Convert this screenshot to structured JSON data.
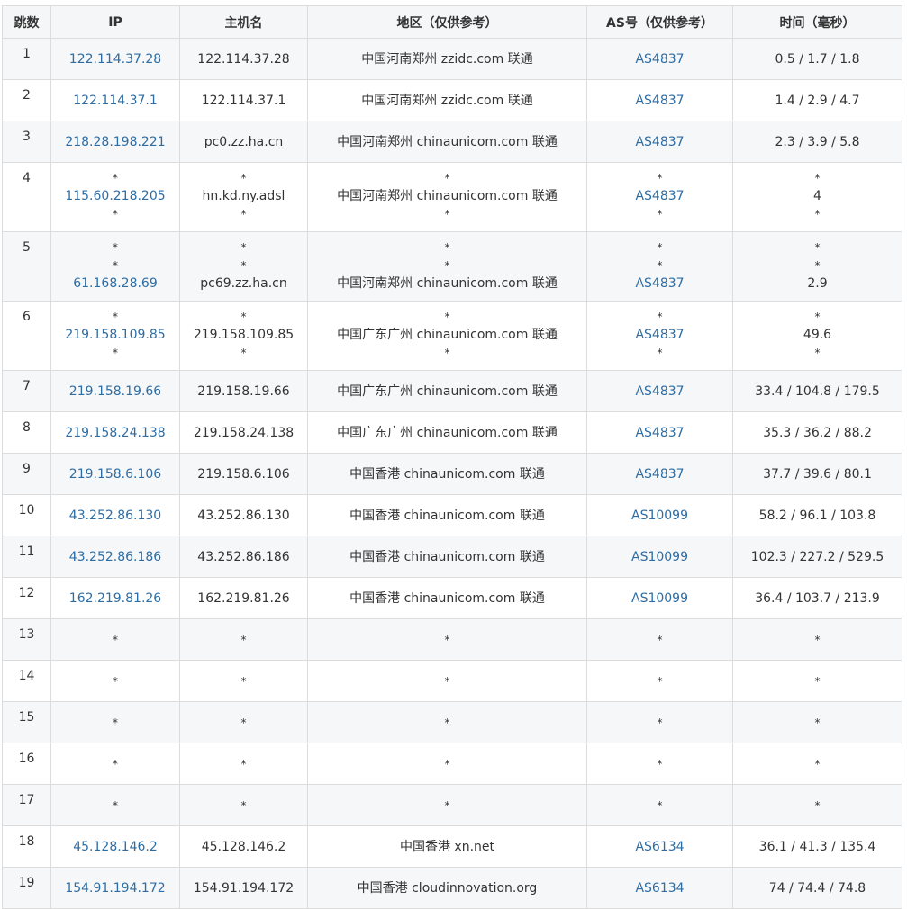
{
  "headers": {
    "hop": "跳数",
    "ip": "IP",
    "host": "主机名",
    "region": "地区（仅供参考）",
    "as": "AS号（仅供参考）",
    "time": "时间（毫秒）"
  },
  "rows": [
    {
      "hop": "1",
      "ip": [
        "122.114.37.28"
      ],
      "host": [
        "122.114.37.28"
      ],
      "region": [
        "中国河南郑州 zzidc.com 联通"
      ],
      "as": [
        "AS4837"
      ],
      "time": [
        "0.5 / 1.7 / 1.8"
      ]
    },
    {
      "hop": "2",
      "ip": [
        "122.114.37.1"
      ],
      "host": [
        "122.114.37.1"
      ],
      "region": [
        "中国河南郑州 zzidc.com 联通"
      ],
      "as": [
        "AS4837"
      ],
      "time": [
        "1.4 / 2.9 / 4.7"
      ]
    },
    {
      "hop": "3",
      "ip": [
        "218.28.198.221"
      ],
      "host": [
        "pc0.zz.ha.cn"
      ],
      "region": [
        "中国河南郑州 chinaunicom.com 联通"
      ],
      "as": [
        "AS4837"
      ],
      "time": [
        "2.3 / 3.9 / 5.8"
      ]
    },
    {
      "hop": "4",
      "ip": [
        "*",
        "115.60.218.205",
        "*"
      ],
      "host": [
        "*",
        "hn.kd.ny.adsl",
        "*"
      ],
      "region": [
        "*",
        "中国河南郑州 chinaunicom.com 联通",
        "*"
      ],
      "as": [
        "*",
        "AS4837",
        "*"
      ],
      "time": [
        "*",
        "4",
        "*"
      ]
    },
    {
      "hop": "5",
      "ip": [
        "*",
        "*",
        "61.168.28.69"
      ],
      "host": [
        "*",
        "*",
        "pc69.zz.ha.cn"
      ],
      "region": [
        "*",
        "*",
        "中国河南郑州 chinaunicom.com 联通"
      ],
      "as": [
        "*",
        "*",
        "AS4837"
      ],
      "time": [
        "*",
        "*",
        "2.9"
      ]
    },
    {
      "hop": "6",
      "ip": [
        "*",
        "219.158.109.85",
        "*"
      ],
      "host": [
        "*",
        "219.158.109.85",
        "*"
      ],
      "region": [
        "*",
        "中国广东广州 chinaunicom.com 联通",
        "*"
      ],
      "as": [
        "*",
        "AS4837",
        "*"
      ],
      "time": [
        "*",
        "49.6",
        "*"
      ]
    },
    {
      "hop": "7",
      "ip": [
        "219.158.19.66"
      ],
      "host": [
        "219.158.19.66"
      ],
      "region": [
        "中国广东广州 chinaunicom.com 联通"
      ],
      "as": [
        "AS4837"
      ],
      "time": [
        "33.4 / 104.8 / 179.5"
      ]
    },
    {
      "hop": "8",
      "ip": [
        "219.158.24.138"
      ],
      "host": [
        "219.158.24.138"
      ],
      "region": [
        "中国广东广州 chinaunicom.com 联通"
      ],
      "as": [
        "AS4837"
      ],
      "time": [
        "35.3 / 36.2 / 88.2"
      ]
    },
    {
      "hop": "9",
      "ip": [
        "219.158.6.106"
      ],
      "host": [
        "219.158.6.106"
      ],
      "region": [
        "中国香港 chinaunicom.com 联通"
      ],
      "as": [
        "AS4837"
      ],
      "time": [
        "37.7 / 39.6 / 80.1"
      ]
    },
    {
      "hop": "10",
      "ip": [
        "43.252.86.130"
      ],
      "host": [
        "43.252.86.130"
      ],
      "region": [
        "中国香港 chinaunicom.com 联通"
      ],
      "as": [
        "AS10099"
      ],
      "time": [
        "58.2 / 96.1 / 103.8"
      ]
    },
    {
      "hop": "11",
      "ip": [
        "43.252.86.186"
      ],
      "host": [
        "43.252.86.186"
      ],
      "region": [
        "中国香港 chinaunicom.com 联通"
      ],
      "as": [
        "AS10099"
      ],
      "time": [
        "102.3 / 227.2 / 529.5"
      ]
    },
    {
      "hop": "12",
      "ip": [
        "162.219.81.26"
      ],
      "host": [
        "162.219.81.26"
      ],
      "region": [
        "中国香港 chinaunicom.com 联通"
      ],
      "as": [
        "AS10099"
      ],
      "time": [
        "36.4 / 103.7 / 213.9"
      ]
    },
    {
      "hop": "13",
      "ip": [
        "*"
      ],
      "host": [
        "*"
      ],
      "region": [
        "*"
      ],
      "as": [
        "*"
      ],
      "time": [
        "*"
      ]
    },
    {
      "hop": "14",
      "ip": [
        "*"
      ],
      "host": [
        "*"
      ],
      "region": [
        "*"
      ],
      "as": [
        "*"
      ],
      "time": [
        "*"
      ]
    },
    {
      "hop": "15",
      "ip": [
        "*"
      ],
      "host": [
        "*"
      ],
      "region": [
        "*"
      ],
      "as": [
        "*"
      ],
      "time": [
        "*"
      ]
    },
    {
      "hop": "16",
      "ip": [
        "*"
      ],
      "host": [
        "*"
      ],
      "region": [
        "*"
      ],
      "as": [
        "*"
      ],
      "time": [
        "*"
      ]
    },
    {
      "hop": "17",
      "ip": [
        "*"
      ],
      "host": [
        "*"
      ],
      "region": [
        "*"
      ],
      "as": [
        "*"
      ],
      "time": [
        "*"
      ]
    },
    {
      "hop": "18",
      "ip": [
        "45.128.146.2"
      ],
      "host": [
        "45.128.146.2"
      ],
      "region": [
        "中国香港 xn.net"
      ],
      "as": [
        "AS6134"
      ],
      "time": [
        "36.1 / 41.3 / 135.4"
      ]
    },
    {
      "hop": "19",
      "ip": [
        "154.91.194.172"
      ],
      "host": [
        "154.91.194.172"
      ],
      "region": [
        "中国香港 cloudinnovation.org"
      ],
      "as": [
        "AS6134"
      ],
      "time": [
        "74 / 74.4 / 74.8"
      ]
    }
  ],
  "colors": {
    "link": "#2e6da4",
    "text": "#333333",
    "border": "#dcdcdc",
    "header_bg": "#f5f6f7",
    "stripe_bg": "#f6f7f8"
  }
}
